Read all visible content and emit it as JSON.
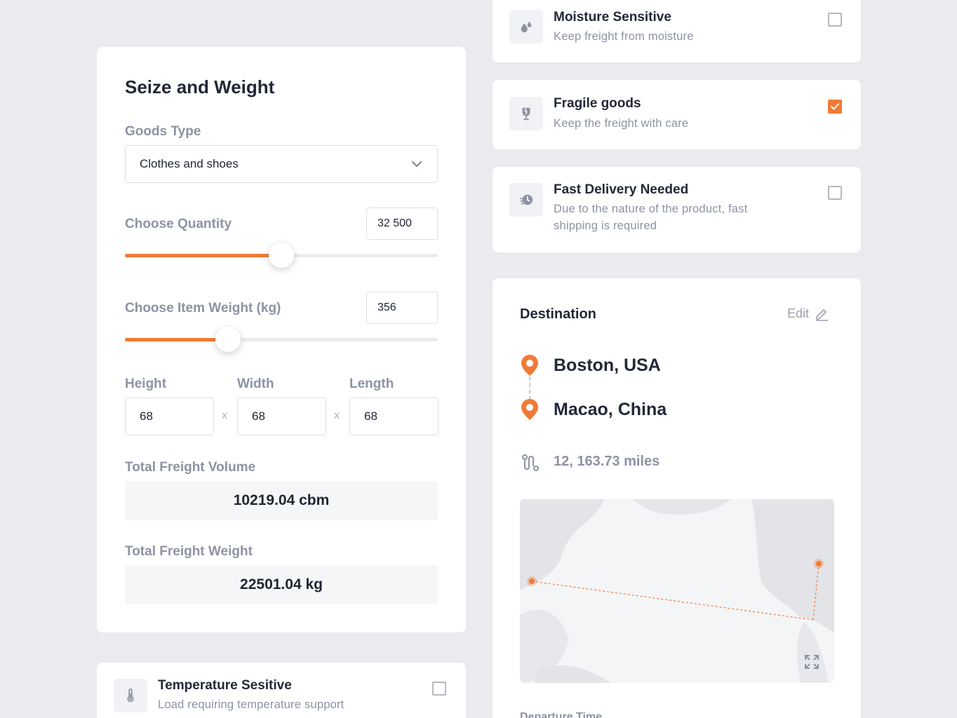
{
  "size_weight": {
    "title": "Seize and Weight",
    "goods_type_label": "Goods Type",
    "goods_type_value": "Clothes and shoes",
    "quantity_label": "Choose Quantity",
    "quantity_value": "32 500",
    "quantity_slider_fraction": 0.5,
    "item_weight_label": "Choose Item Weight (kg)",
    "item_weight_value": "356",
    "item_weight_slider_fraction": 0.33,
    "height_label": "Height",
    "width_label": "Width",
    "length_label": "Length",
    "height_value": "68",
    "width_value": "68",
    "length_value": "68",
    "times_symbol": "x",
    "total_volume_label": "Total Freight Volume",
    "total_volume_value": "10219.04 cbm",
    "total_weight_label": "Total Freight Weight",
    "total_weight_value": "22501.04 kg"
  },
  "options": {
    "moisture": {
      "title": "Moisture Sensitive",
      "subtitle": "Keep freight from moisture",
      "checked": false,
      "icon": "droplets-icon"
    },
    "fragile": {
      "title": "Fragile goods",
      "subtitle": "Keep the freight with care",
      "checked": true,
      "icon": "fragile-glass-icon"
    },
    "fast": {
      "title": "Fast Delivery Needed",
      "subtitle_line1": "Due to the nature of the product, fast",
      "subtitle_line2": "shipping is required",
      "checked": false,
      "icon": "fast-clock-icon"
    },
    "temperature": {
      "title": "Temperature Sesitive",
      "subtitle": "Load requiring temperature support",
      "checked": false,
      "icon": "thermometer-icon"
    }
  },
  "destination": {
    "title": "Destination",
    "edit_label": "Edit",
    "origin": "Boston, USA",
    "target": "Macao, China",
    "distance": "12, 163.73 miles",
    "departure_label": "Departure Time"
  },
  "colors": {
    "accent": "#f07a35",
    "background": "#eaebee",
    "muted_text": "#8d93a3"
  }
}
